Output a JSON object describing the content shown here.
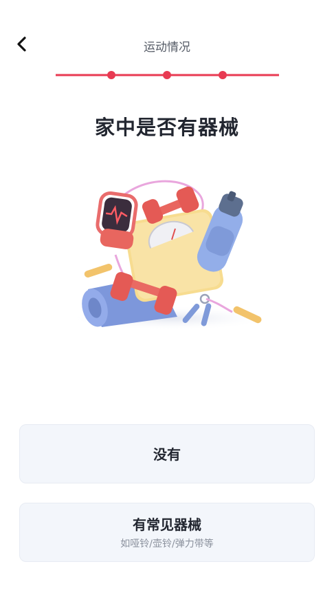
{
  "header": {
    "title": "运动情况",
    "back_icon": "chevron-left-icon"
  },
  "progress": {
    "steps": 4,
    "current_step": 4,
    "accent_color": "#e83a52"
  },
  "question": {
    "heading": "家中是否有器械"
  },
  "illustration": {
    "icon": "fitness-equipment-illustration"
  },
  "options": [
    {
      "label": "没有"
    },
    {
      "label": "有常见器械",
      "sublabel": "如哑铃/壶铃/弹力带等"
    }
  ]
}
